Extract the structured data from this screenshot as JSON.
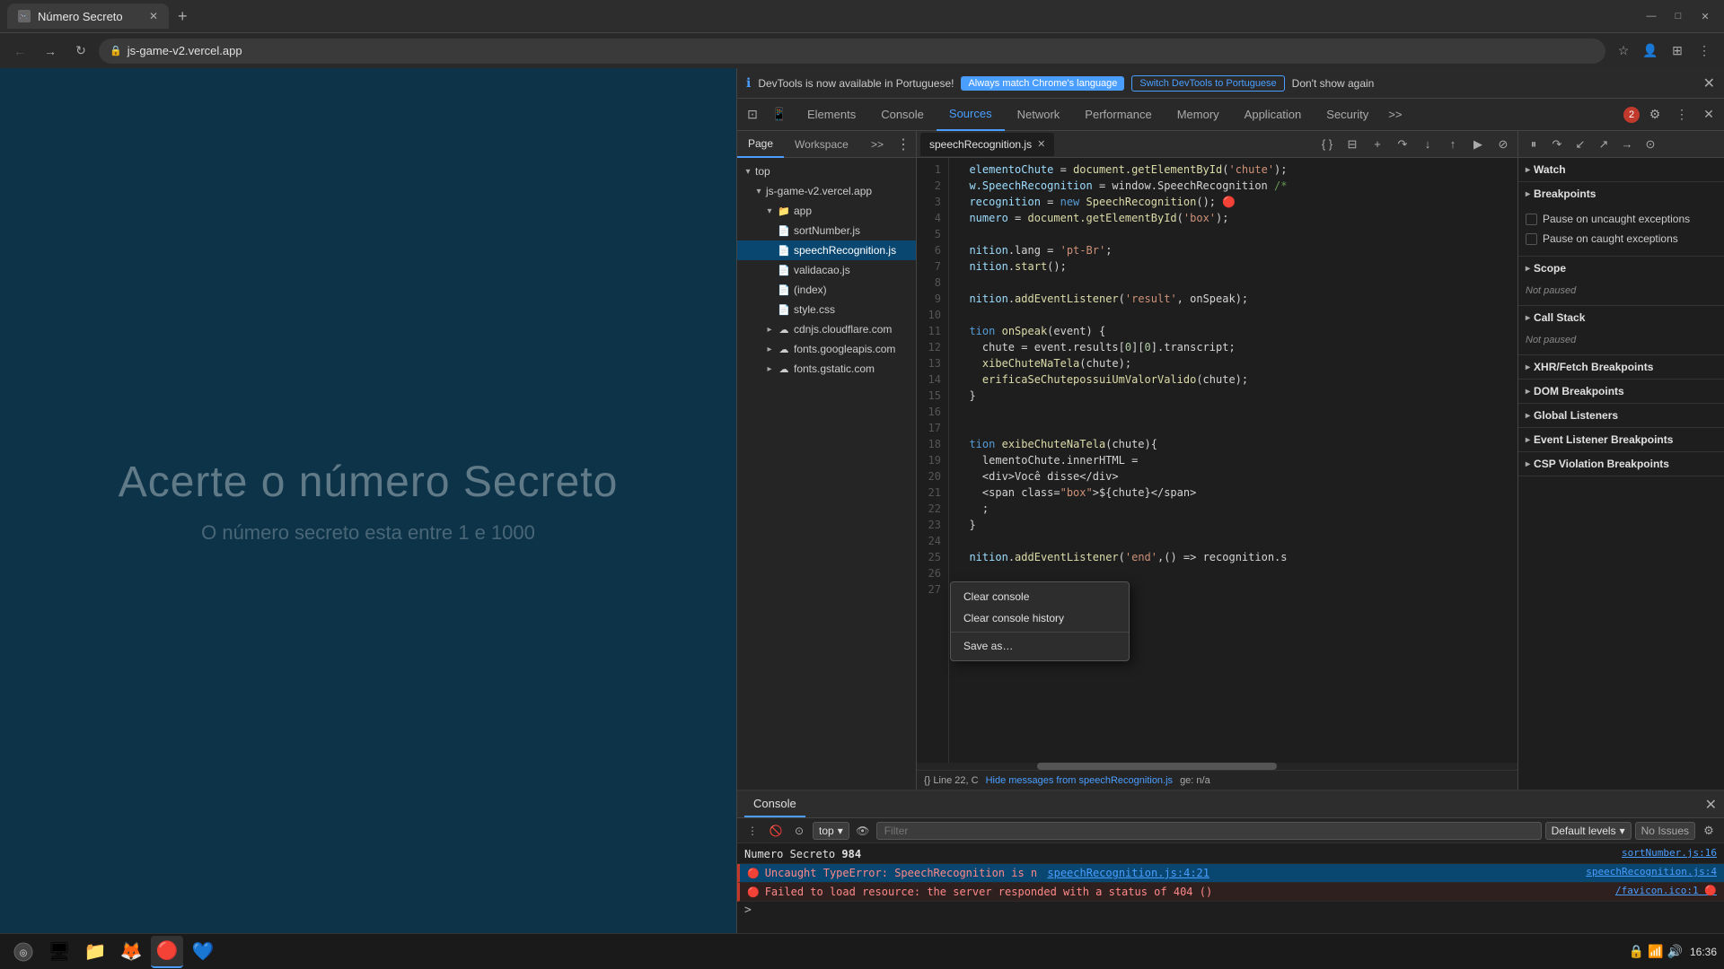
{
  "browser": {
    "tab_title": "Número Secreto",
    "tab_favicon": "🎮",
    "new_tab_label": "+",
    "address": "js-game-v2.vercel.app",
    "controls": [
      "—",
      "□",
      "✕"
    ]
  },
  "devtools": {
    "notification": {
      "icon": "ℹ",
      "message": "DevTools is now available in Portuguese!",
      "btn_always": "Always match Chrome's language",
      "btn_switch": "Switch DevTools to Portuguese",
      "btn_dont": "Don't show again",
      "close": "✕"
    },
    "top_tabs": [
      "Elements",
      "Console",
      "Sources",
      "Network",
      "Performance",
      "Memory",
      "Application",
      "Security"
    ],
    "more_tabs": ">>",
    "error_count": "2",
    "tab_icons_left": [
      "☰",
      "⊙"
    ],
    "active_tab": "Sources"
  },
  "sources": {
    "navigator_tabs": [
      "Page",
      "Workspace",
      ">>"
    ],
    "file_tree": [
      {
        "label": "top",
        "type": "root",
        "expanded": true,
        "indent": 0
      },
      {
        "label": "js-game-v2.vercel.app",
        "type": "domain",
        "expanded": true,
        "indent": 1
      },
      {
        "label": "app",
        "type": "folder",
        "expanded": true,
        "indent": 2
      },
      {
        "label": "sortNumber.js",
        "type": "js",
        "indent": 3
      },
      {
        "label": "speechRecognition.js",
        "type": "js",
        "indent": 3,
        "active": true
      },
      {
        "label": "validacao.js",
        "type": "js",
        "indent": 3
      },
      {
        "label": "(index)",
        "type": "html",
        "indent": 3
      },
      {
        "label": "style.css",
        "type": "css",
        "indent": 3
      },
      {
        "label": "cdnjs.cloudflare.com",
        "type": "domain",
        "expanded": false,
        "indent": 2
      },
      {
        "label": "fonts.googleapis.com",
        "type": "domain",
        "expanded": false,
        "indent": 2
      },
      {
        "label": "fonts.gstatic.com",
        "type": "domain",
        "expanded": false,
        "indent": 2
      }
    ],
    "active_file": "speechRecognition.js",
    "code_lines": [
      "  elementoChute = document.getElementById('chute');",
      "  w.SpeechRecognition = window.SpeechRecognition /*",
      "  recognition = new SpeechRecognition(); 🔴",
      "  numero = document.getElementById('box');",
      "",
      "  nition.lang = 'pt-Br';",
      "  nition.start();",
      "",
      "  nition.addEventListener('result', onSpeak);",
      "",
      "  tion onSpeak(event) {",
      "    chute = event.results[0][0].transcript;",
      "    xibeChuteNaTela(chute);",
      "    erificaSeChutepossuiUmValorValido(chute);",
      "  }",
      "",
      "",
      "  tion exibeChuteNaTela(chute){",
      "    lementoChute.innerHTML =",
      "    <div>Você disse</div>",
      "    <span class=\"box\">${chute}</span>",
      "    ;",
      "  }",
      "",
      "  nition.addEventListener('end',() => recognition.s",
      "",
      ""
    ],
    "footer_text": "{} Line 22, C",
    "footer_file": "Hide messages from speechRecognition.js",
    "footer_col": "ge: n/a"
  },
  "right_panel": {
    "sections": [
      {
        "label": "Watch",
        "expanded": true,
        "items": []
      },
      {
        "label": "Breakpoints",
        "expanded": true,
        "items": [
          {
            "type": "checkbox",
            "label": "Pause on uncaught exceptions"
          },
          {
            "type": "checkbox",
            "label": "Pause on caught exceptions"
          }
        ]
      },
      {
        "label": "Scope",
        "expanded": true,
        "status": "Not paused"
      },
      {
        "label": "Call Stack",
        "expanded": true,
        "status": "Not paused"
      },
      {
        "label": "XHR/Fetch Breakpoints",
        "expanded": false
      },
      {
        "label": "DOM Breakpoints",
        "expanded": false
      },
      {
        "label": "Global Listeners",
        "expanded": false
      },
      {
        "label": "Event Listener Breakpoints",
        "expanded": false
      },
      {
        "label": "CSP Violation Breakpoints",
        "expanded": false
      }
    ]
  },
  "context_menu": {
    "items": [
      {
        "label": "Clear console"
      },
      {
        "label": "Clear console history"
      },
      {
        "separator": true
      },
      {
        "label": "Save as..."
      }
    ]
  },
  "console": {
    "tab_label": "Console",
    "close": "✕",
    "toolbar": {
      "context": "top",
      "filter_placeholder": "Filter",
      "levels": "Default levels",
      "issues": "No Issues"
    },
    "messages": [
      {
        "type": "info",
        "text": "Numero Secreto",
        "value": "984",
        "source": "sortNumber.js:16"
      },
      {
        "type": "error",
        "text": "Uncaught TypeError: SpeechRecognition is n",
        "link": "speechRecognition.js:4:21",
        "source": "speechRecognition.js:4",
        "selected": true
      },
      {
        "type": "error",
        "text": "Failed to load resource: the server responded with a status of 404 ()",
        "source": "/favicon.ico:1"
      }
    ],
    "prompt": ">"
  },
  "page": {
    "title": "Acerte o número Secreto",
    "subtitle": "O número secreto esta entre 1 e 1000"
  },
  "taskbar": {
    "apps": [
      "🐧",
      "📁",
      "🦊",
      "🔴",
      "💙"
    ],
    "time": "16:36",
    "sys_icons": [
      "🔒",
      "📶",
      "🔊"
    ]
  }
}
